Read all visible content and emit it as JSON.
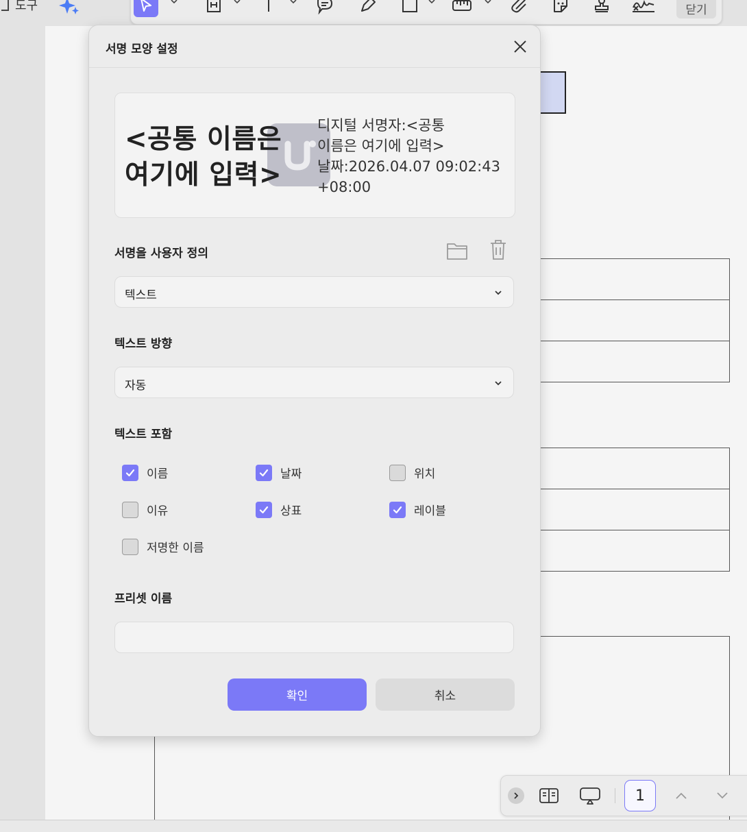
{
  "toolbar": {
    "tools_label": "도구",
    "close_label": "닫기",
    "accent": "#7b79f7"
  },
  "dialog": {
    "title": "서명 모양 설정",
    "preview": {
      "name_line1": "<공통 이름은",
      "name_line2": "여기에 입력>",
      "detail_line1": "디지털 서명자:<공통",
      "detail_line2": "이름은 여기에 입력>",
      "detail_line3": "날짜:2026.04.07 09:02:43",
      "detail_line4": "+08:00"
    },
    "customize_label": "서명을 사용자 정의",
    "customize_value": "텍스트",
    "direction_label": "텍스트 방향",
    "direction_value": "자동",
    "include_label": "텍스트 포함",
    "checkboxes": [
      {
        "label": "이름",
        "checked": true
      },
      {
        "label": "날짜",
        "checked": true
      },
      {
        "label": "위치",
        "checked": false
      },
      {
        "label": "이유",
        "checked": false
      },
      {
        "label": "상표",
        "checked": true
      },
      {
        "label": "레이블",
        "checked": true
      },
      {
        "label": "저명한 이름",
        "checked": false
      }
    ],
    "preset_label": "프리셋 이름",
    "preset_value": "",
    "confirm_label": "확인",
    "cancel_label": "취소"
  },
  "page_nav": {
    "current_page": "1"
  }
}
